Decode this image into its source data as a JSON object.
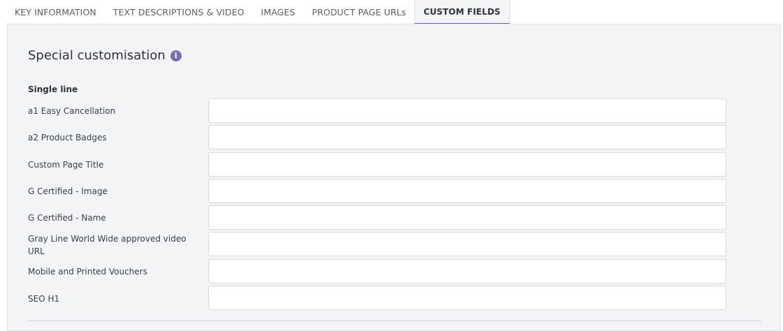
{
  "tabs": [
    {
      "label": "KEY INFORMATION",
      "active": false
    },
    {
      "label": "TEXT DESCRIPTIONS & VIDEO",
      "active": false
    },
    {
      "label": "IMAGES",
      "active": false
    },
    {
      "label": "PRODUCT PAGE URLs",
      "active": false
    },
    {
      "label": "CUSTOM FIELDS",
      "active": true
    }
  ],
  "section": {
    "title": "Special customisation",
    "info_icon": "info-icon",
    "group_label": "Single line"
  },
  "fields": [
    {
      "label": "a1 Easy Cancellation",
      "value": ""
    },
    {
      "label": "a2 Product Badges",
      "value": ""
    },
    {
      "label": "Custom Page Title",
      "value": ""
    },
    {
      "label": "G Certified - Image",
      "value": ""
    },
    {
      "label": "G Certified - Name",
      "value": ""
    },
    {
      "label": "Gray Line World Wide approved video URL",
      "value": ""
    },
    {
      "label": "Mobile and Printed Vouchers",
      "value": ""
    },
    {
      "label": "SEO H1",
      "value": ""
    }
  ],
  "colors": {
    "accent": "#6e62a8",
    "info_icon": "#7b6cb8",
    "panel_bg": "#f3f4f6"
  }
}
